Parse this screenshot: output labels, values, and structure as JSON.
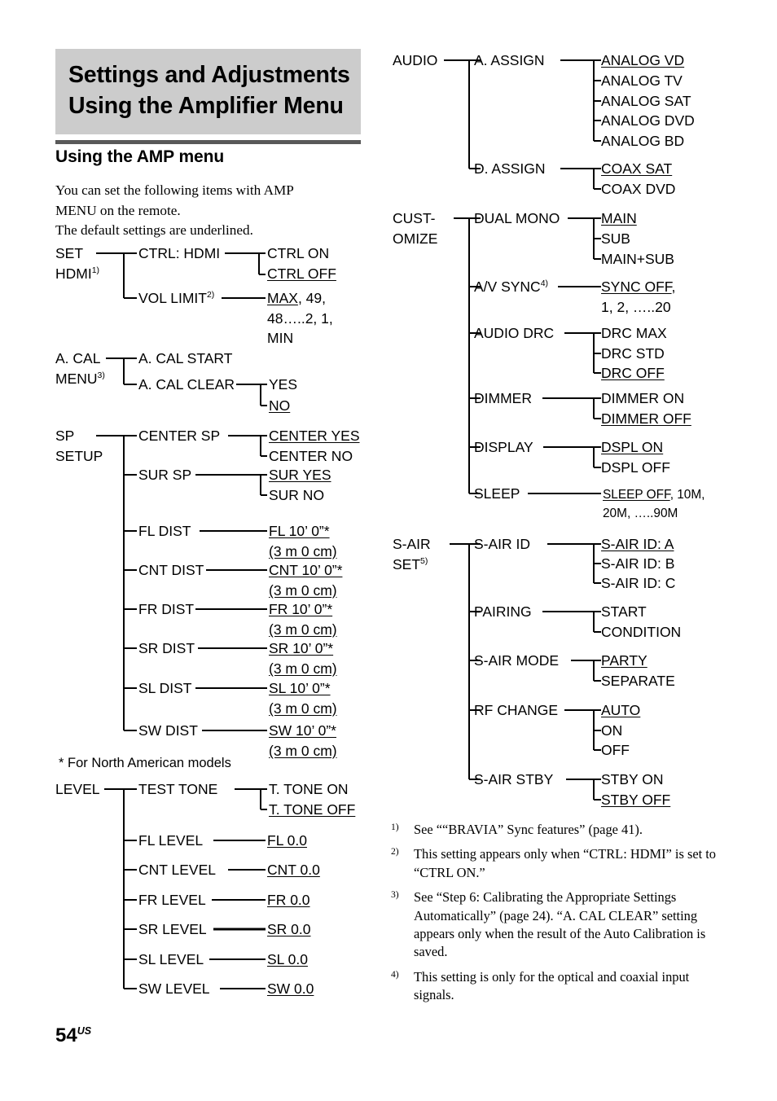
{
  "title": {
    "line1": "Settings and Adjustments",
    "line2": "Using the Amplifier Menu"
  },
  "section": {
    "heading": "Using the AMP menu",
    "intro_line1": "You can set the following items with AMP",
    "intro_line2": "MENU on the remote.",
    "intro_line3": "The default settings are underlined."
  },
  "colors": {
    "banner_bg": "#cccccc",
    "rule": "#595959",
    "text": "#000000"
  },
  "left_tree": {
    "set_hdmi": {
      "root_line1": "SET",
      "root_line2": "HDMI",
      "root_footnote": "1)",
      "ctrl_hdmi_label": "CTRL: HDMI",
      "ctrl_on": "CTRL ON",
      "ctrl_off": "CTRL OFF",
      "vol_limit_label": "VOL LIMIT",
      "vol_limit_footnote": "2)",
      "vol_default": "MAX",
      "vol_rest_line1": ", 49,",
      "vol_rest_line2": "48…..2, 1,",
      "vol_rest_line3": "MIN"
    },
    "a_cal_menu": {
      "root_line1": "A. CAL",
      "root_line2": "MENU",
      "root_footnote": "3)",
      "start_label": "A. CAL START",
      "clear_label": "A. CAL CLEAR",
      "yes": "YES",
      "no": "NO"
    },
    "sp_setup": {
      "root_line1": "SP",
      "root_line2": "SETUP",
      "items": [
        {
          "label": "CENTER SP",
          "values": [
            "CENTER YES",
            "CENTER NO"
          ],
          "default": "CENTER YES"
        },
        {
          "label": "SUR SP",
          "values": [
            "SUR YES",
            "SUR NO"
          ],
          "default": "SUR YES"
        },
        {
          "label": "FL DIST",
          "values": [
            "FL 10’ 0”*",
            "(3 m 0 cm)"
          ],
          "default": "both"
        },
        {
          "label": "CNT DIST",
          "values": [
            "CNT 10’ 0”*",
            "(3 m 0 cm)"
          ],
          "default": "both"
        },
        {
          "label": "FR DIST",
          "values": [
            "FR 10’ 0”*",
            "(3 m 0 cm)"
          ],
          "default": "both"
        },
        {
          "label": "SR DIST",
          "values": [
            "SR 10’ 0”*",
            "(3 m 0 cm)"
          ],
          "default": "both"
        },
        {
          "label": "SL DIST",
          "values": [
            "SL 10’ 0”*",
            "(3 m 0 cm)"
          ],
          "default": "both"
        },
        {
          "label": "SW DIST",
          "values": [
            "SW 10’ 0”*",
            "(3 m 0 cm)"
          ],
          "default": "both"
        }
      ]
    },
    "star_note": "* For North American models",
    "level": {
      "root": "LEVEL",
      "items": [
        {
          "label": "TEST TONE",
          "values": [
            "T. TONE ON",
            "T. TONE OFF"
          ],
          "default": "T. TONE OFF"
        },
        {
          "label": "FL LEVEL",
          "values": [
            "FL 0.0"
          ],
          "default": "FL 0.0"
        },
        {
          "label": "CNT LEVEL",
          "values": [
            "CNT 0.0"
          ],
          "default": "CNT 0.0"
        },
        {
          "label": "FR LEVEL",
          "values": [
            "FR 0.0"
          ],
          "default": "FR 0.0"
        },
        {
          "label": "SR LEVEL",
          "values": [
            "SR 0.0"
          ],
          "default": "SR 0.0"
        },
        {
          "label": "SL LEVEL",
          "values": [
            "SL 0.0"
          ],
          "default": "SL 0.0"
        },
        {
          "label": "SW LEVEL",
          "values": [
            "SW 0.0"
          ],
          "default": "SW 0.0"
        }
      ]
    }
  },
  "right_tree": {
    "audio": {
      "root": "AUDIO",
      "a_assign_label": "A. ASSIGN",
      "a_assign_values": [
        "ANALOG VD",
        "ANALOG TV",
        "ANALOG SAT",
        "ANALOG DVD",
        "ANALOG BD"
      ],
      "a_assign_default": "ANALOG VD",
      "d_assign_label": "D. ASSIGN",
      "d_assign_values": [
        "COAX SAT",
        "COAX DVD"
      ],
      "d_assign_default": "COAX SAT"
    },
    "customize": {
      "root_line1": "CUST-",
      "root_line2": "OMIZE",
      "dual_mono_label": "DUAL MONO",
      "dual_mono_values": [
        "MAIN",
        "SUB",
        "MAIN+SUB"
      ],
      "dual_mono_default": "MAIN",
      "av_sync_label": "A/V SYNC",
      "av_sync_footnote": "4)",
      "av_sync_default": "SYNC OFF",
      "av_sync_rest_line1": ",",
      "av_sync_rest_line2": "1, 2, …..20",
      "audio_drc_label": "AUDIO DRC",
      "audio_drc_values": [
        "DRC MAX",
        "DRC STD",
        "DRC OFF"
      ],
      "audio_drc_default": "DRC OFF",
      "dimmer_label": "DIMMER",
      "dimmer_values": [
        "DIMMER ON",
        "DIMMER OFF"
      ],
      "dimmer_default": "DIMMER OFF",
      "display_label": "DISPLAY",
      "display_values": [
        "DSPL ON",
        "DSPL OFF"
      ],
      "display_default": "DSPL ON",
      "sleep_label": "SLEEP",
      "sleep_default": "SLEEP OFF",
      "sleep_rest_line1": ", 10M,",
      "sleep_rest_line2": "20M, …..90M"
    },
    "s_air_set": {
      "root_line1": "S-AIR",
      "root_line2": "SET",
      "root_footnote": "5)",
      "items": [
        {
          "label": "S-AIR ID",
          "values": [
            "S-AIR ID: A",
            "S-AIR ID: B",
            "S-AIR ID: C"
          ],
          "default": "S-AIR ID: A"
        },
        {
          "label": "PAIRING",
          "values": [
            "START",
            "CONDITION"
          ],
          "default": ""
        },
        {
          "label": "S-AIR MODE",
          "values": [
            "PARTY",
            "SEPARATE"
          ],
          "default": "PARTY"
        },
        {
          "label": "RF CHANGE",
          "values": [
            "AUTO",
            "ON",
            "OFF"
          ],
          "default": "AUTO"
        },
        {
          "label": "S-AIR STBY",
          "values": [
            "STBY ON",
            "STBY OFF"
          ],
          "default": "STBY OFF"
        }
      ]
    }
  },
  "footnotes": [
    {
      "marker": "1)",
      "text": "See ““BRAVIA” Sync features” (page 41)."
    },
    {
      "marker": "2)",
      "text": "This setting appears only when “CTRL: HDMI” is set to “CTRL ON.”"
    },
    {
      "marker": "3)",
      "text": "See “Step 6: Calibrating the Appropriate Settings Automatically” (page 24). “A. CAL CLEAR” setting appears only when the result of the Auto Calibration is saved."
    },
    {
      "marker": "4)",
      "text": "This setting is only for the optical and coaxial input signals."
    }
  ],
  "page": {
    "number": "54",
    "suffix": "US"
  }
}
